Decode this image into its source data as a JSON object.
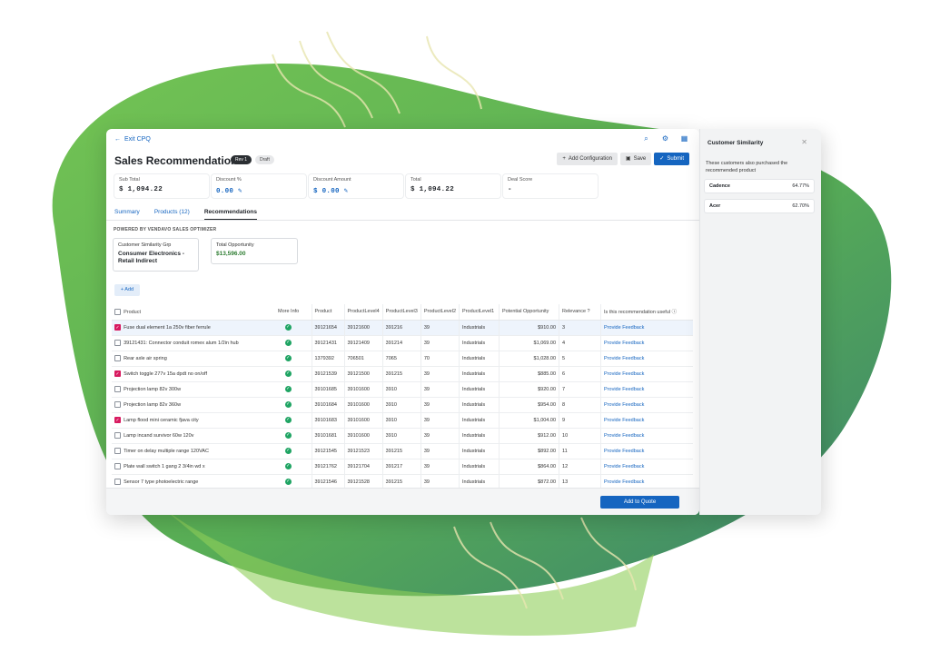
{
  "header": {
    "exit_label": "Exit CPQ",
    "title": "Sales Recommendations",
    "rev_badge": "Rev 1",
    "status_badge": "Draft",
    "buttons": {
      "add_config": "Add Configuration",
      "save": "Save",
      "submit": "Submit"
    }
  },
  "metrics": [
    {
      "label": "Sub Total",
      "value": "$ 1,094.22"
    },
    {
      "label": "Discount %",
      "value": "0.00"
    },
    {
      "label": "Discount Amount",
      "value": "$ 0.00"
    },
    {
      "label": "Total",
      "value": "$ 1,094.22"
    },
    {
      "label": "Deal Score",
      "value": "-"
    }
  ],
  "tabs": [
    "Summary",
    "Products (12)",
    "Recommendations"
  ],
  "powered_by": "POWERED BY VENDAVO SALES OPTIMIZER",
  "info_boxes": {
    "group_label": "Customer Similarity Grp",
    "group_value": "Consumer Electronics - Retail Indirect",
    "opportunity_label": "Total Opportunity",
    "opportunity_value": "$13,596.00"
  },
  "add_button": "+ Add",
  "table": {
    "columns": [
      "Product",
      "More Info",
      "Product",
      "ProductLevel4",
      "ProductLevel3",
      "ProductLevel2",
      "ProductLevel1",
      "Potential Opportunity",
      "Relevance",
      "Is this recommendation useful"
    ],
    "rows": [
      {
        "name": "Fuse dual element 1a 250v fiber ferrule",
        "checked": true,
        "product": "39121654",
        "l4": "39121600",
        "l3": "391216",
        "l2": "39",
        "l1": "Industrials",
        "opp": "$910.00",
        "rel": "3",
        "feedback": "Provide Feedback"
      },
      {
        "name": "39121431: Connector conduit romex alum 1/2in hub",
        "checked": false,
        "product": "39121431",
        "l4": "39121409",
        "l3": "391214",
        "l2": "39",
        "l1": "Industrials",
        "opp": "$1,069.00",
        "rel": "4",
        "feedback": "Provide Feedback"
      },
      {
        "name": "Rear axle air spring",
        "checked": false,
        "product": "1379392",
        "l4": "706501",
        "l3": "7065",
        "l2": "70",
        "l1": "Industrials",
        "opp": "$1,028.00",
        "rel": "5",
        "feedback": "Provide Feedback"
      },
      {
        "name": "Switch toggle 277v 15a dpdt no on/off",
        "checked": true,
        "product": "39121539",
        "l4": "39121500",
        "l3": "391215",
        "l2": "39",
        "l1": "Industrials",
        "opp": "$885.00",
        "rel": "6",
        "feedback": "Provide Feedback"
      },
      {
        "name": "Projection lamp 82v 300w",
        "checked": false,
        "product": "39101685",
        "l4": "39101600",
        "l3": "3910",
        "l2": "39",
        "l1": "Industrials",
        "opp": "$920.00",
        "rel": "7",
        "feedback": "Provide Feedback"
      },
      {
        "name": "Projection lamp 82v 360w",
        "checked": false,
        "product": "39101684",
        "l4": "39101600",
        "l3": "3910",
        "l2": "39",
        "l1": "Industrials",
        "opp": "$954.00",
        "rel": "8",
        "feedback": "Provide Feedback"
      },
      {
        "name": "Lamp flood mini ceramic fjava city",
        "checked": true,
        "product": "39101683",
        "l4": "39101600",
        "l3": "3910",
        "l2": "39",
        "l1": "Industrials",
        "opp": "$1,004.00",
        "rel": "9",
        "feedback": "Provide Feedback"
      },
      {
        "name": "Lamp incand survivor 60w 120v",
        "checked": false,
        "product": "39101681",
        "l4": "39101600",
        "l3": "3910",
        "l2": "39",
        "l1": "Industrials",
        "opp": "$912.00",
        "rel": "10",
        "feedback": "Provide Feedback"
      },
      {
        "name": "Timer on delay multiple range 120VAC",
        "checked": false,
        "product": "39121545",
        "l4": "39121523",
        "l3": "391215",
        "l2": "39",
        "l1": "Industrials",
        "opp": "$892.00",
        "rel": "11",
        "feedback": "Provide Feedback"
      },
      {
        "name": "Plate wall switch 1 gang 2 3/4in wd x",
        "checked": false,
        "product": "39121762",
        "l4": "39121704",
        "l3": "391217",
        "l2": "39",
        "l1": "Industrials",
        "opp": "$864.00",
        "rel": "12",
        "feedback": "Provide Feedback"
      },
      {
        "name": "Sensor 7 type photoelectric range",
        "checked": false,
        "product": "39121546",
        "l4": "39121528",
        "l3": "391215",
        "l2": "39",
        "l1": "Industrials",
        "opp": "$872.00",
        "rel": "13",
        "feedback": "Provide Feedback"
      }
    ]
  },
  "footer": {
    "add_to_quote": "Add to Quote"
  },
  "side_panel": {
    "title": "Customer Similarity",
    "description": "These customers also purchased the recommended product",
    "items": [
      {
        "name": "Cadence",
        "value": "64.77%"
      },
      {
        "name": "Acer",
        "value": "62.70%"
      }
    ]
  },
  "colors": {
    "accent": "#1565c0",
    "brand_green": "#5cb85c",
    "check_magenta": "#d81b60"
  }
}
